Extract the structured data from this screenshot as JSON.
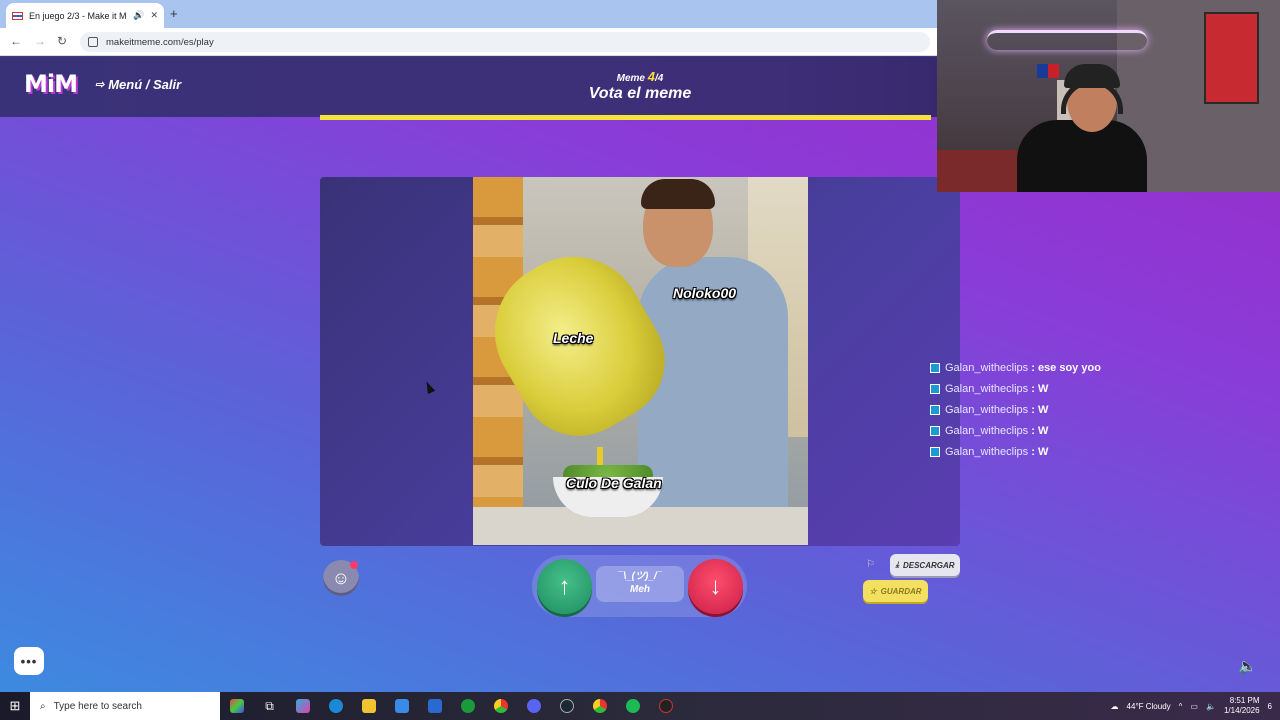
{
  "browser": {
    "tab_title": "En juego 2/3 - Make it Meme",
    "new_tab": "+",
    "url": "makeitmeme.com/es/play"
  },
  "app": {
    "logo": "MiM",
    "menu_label": "Menú / Salir",
    "round_prefix": "Meme",
    "round_current": "4",
    "round_total": "/4",
    "round_title": "Vota el meme",
    "progress": 1.0
  },
  "meme": {
    "captions": [
      "Noloko00",
      "Leche",
      "Culo De Galan"
    ]
  },
  "chat": {
    "messages": [
      {
        "user": "Galan_witheclips",
        "sep": " : ",
        "text": "ese soy yoo"
      },
      {
        "user": "Galan_witheclips",
        "sep": " : ",
        "text": "W"
      },
      {
        "user": "Galan_witheclips",
        "sep": " : ",
        "text": "W"
      },
      {
        "user": "Galan_witheclips",
        "sep": " : ",
        "text": "W"
      },
      {
        "user": "Galan_witheclips",
        "sep": " : ",
        "text": "W"
      }
    ]
  },
  "vote": {
    "meh_face": "¯\\_(ツ)_/¯",
    "meh_label": "Meh"
  },
  "actions": {
    "download": "DESCARGAR",
    "save": "GUARDAR"
  },
  "taskbar": {
    "search_placeholder": "Type here to search",
    "weather": "44°F  Cloudy",
    "time": "8:51 PM",
    "date": "1/14/2026",
    "notifications": "6"
  }
}
